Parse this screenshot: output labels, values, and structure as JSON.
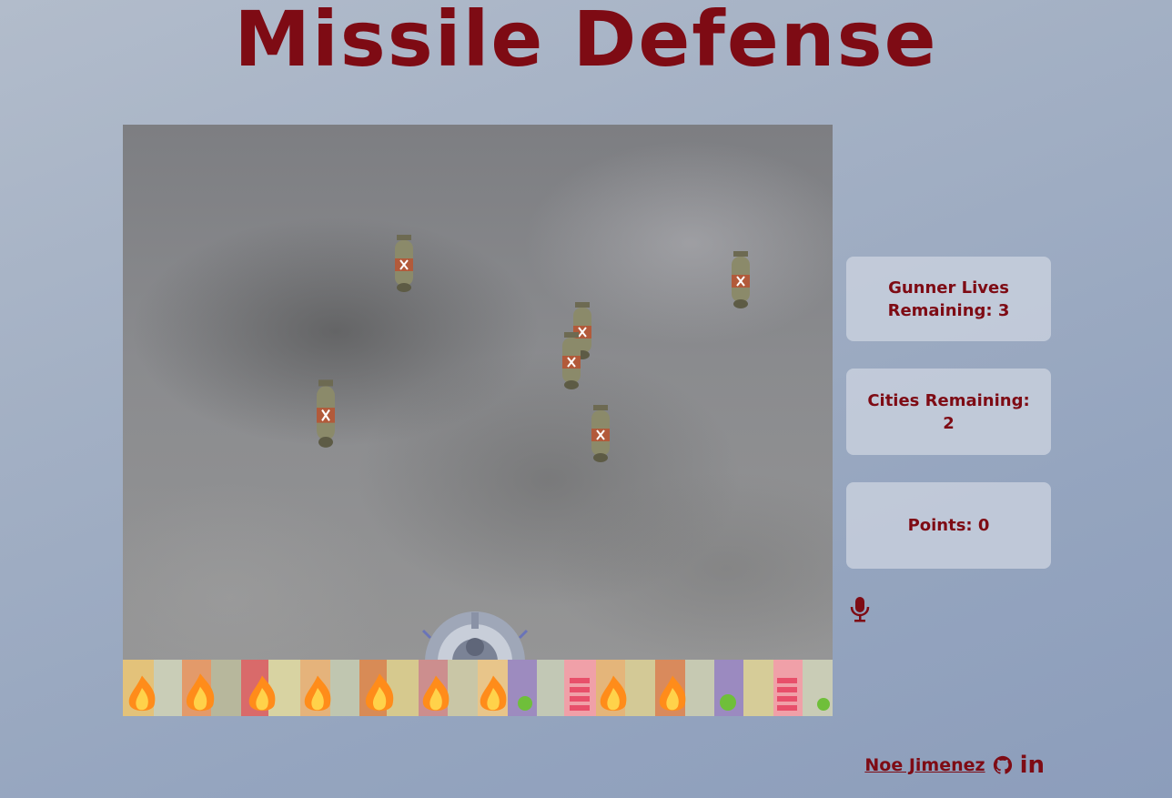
{
  "header": {
    "title": "Missile Defense"
  },
  "stats": {
    "lives": "Gunner Lives Remaining: 3",
    "cities": "Cities Remaining: 2",
    "points": "Points: 0"
  },
  "controls": {
    "mic_icon": "microphone-icon"
  },
  "footer": {
    "author": "Noe Jimenez",
    "github_icon": "github-icon",
    "linkedin_label": "in"
  },
  "game": {
    "missile_icon": "bomb",
    "cannon_icon": "gunner-turret",
    "city_blocks": 12,
    "colors": {
      "accent": "#7e0b14",
      "panel": "#cdd4e0"
    }
  }
}
